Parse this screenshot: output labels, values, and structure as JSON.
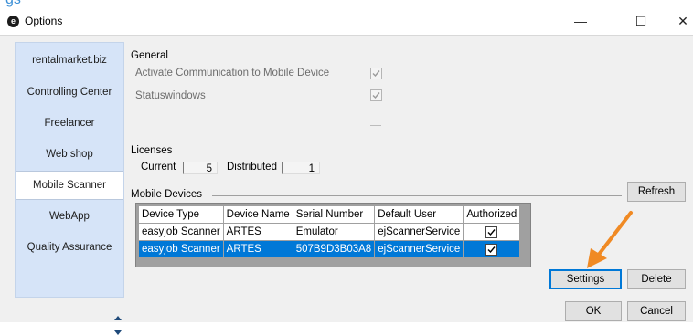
{
  "window": {
    "title": "Options",
    "app_icon": "e-logo-icon",
    "cropped_heading": "gs"
  },
  "titlebar_buttons": [
    "minimize-icon",
    "maximize-icon",
    "close-icon"
  ],
  "sidebar": {
    "items": [
      {
        "label": "rentalmarket.biz"
      },
      {
        "label": "Controlling Center"
      },
      {
        "label": "Freelancer"
      },
      {
        "label": "Web shop"
      },
      {
        "label": "Mobile Scanner",
        "active": true
      },
      {
        "label": "WebApp"
      },
      {
        "label": "Quality Assurance"
      }
    ]
  },
  "general": {
    "title": "General",
    "activate_label": "Activate Communication to Mobile Device",
    "activate_checked": true,
    "status_label": "Statuswindows",
    "status_checked": true
  },
  "licenses": {
    "title": "Licenses",
    "current_label": "Current",
    "current_value": "5",
    "distributed_label": "Distributed",
    "distributed_value": "1"
  },
  "devices": {
    "title": "Mobile Devices",
    "refresh_label": "Refresh",
    "columns": [
      "Device Type",
      "Device Name",
      "Serial Number",
      "Default User",
      "Authorized"
    ],
    "rows": [
      {
        "type": "easyjob Scanner",
        "name": "ARTES",
        "serial": "Emulator",
        "user": "ejScannerService",
        "authorized": true,
        "selected": false
      },
      {
        "type": "easyjob Scanner",
        "name": "ARTES",
        "serial": "507B9D3B03A8",
        "user": "ejScannerService",
        "authorized": true,
        "selected": true
      }
    ],
    "settings_label": "Settings",
    "delete_label": "Delete"
  },
  "footer": {
    "ok_label": "OK",
    "cancel_label": "Cancel"
  },
  "colors": {
    "sidebar_bg": "#d6e4f8",
    "selection": "#0078d7",
    "annotation_arrow": "#f08a24"
  }
}
